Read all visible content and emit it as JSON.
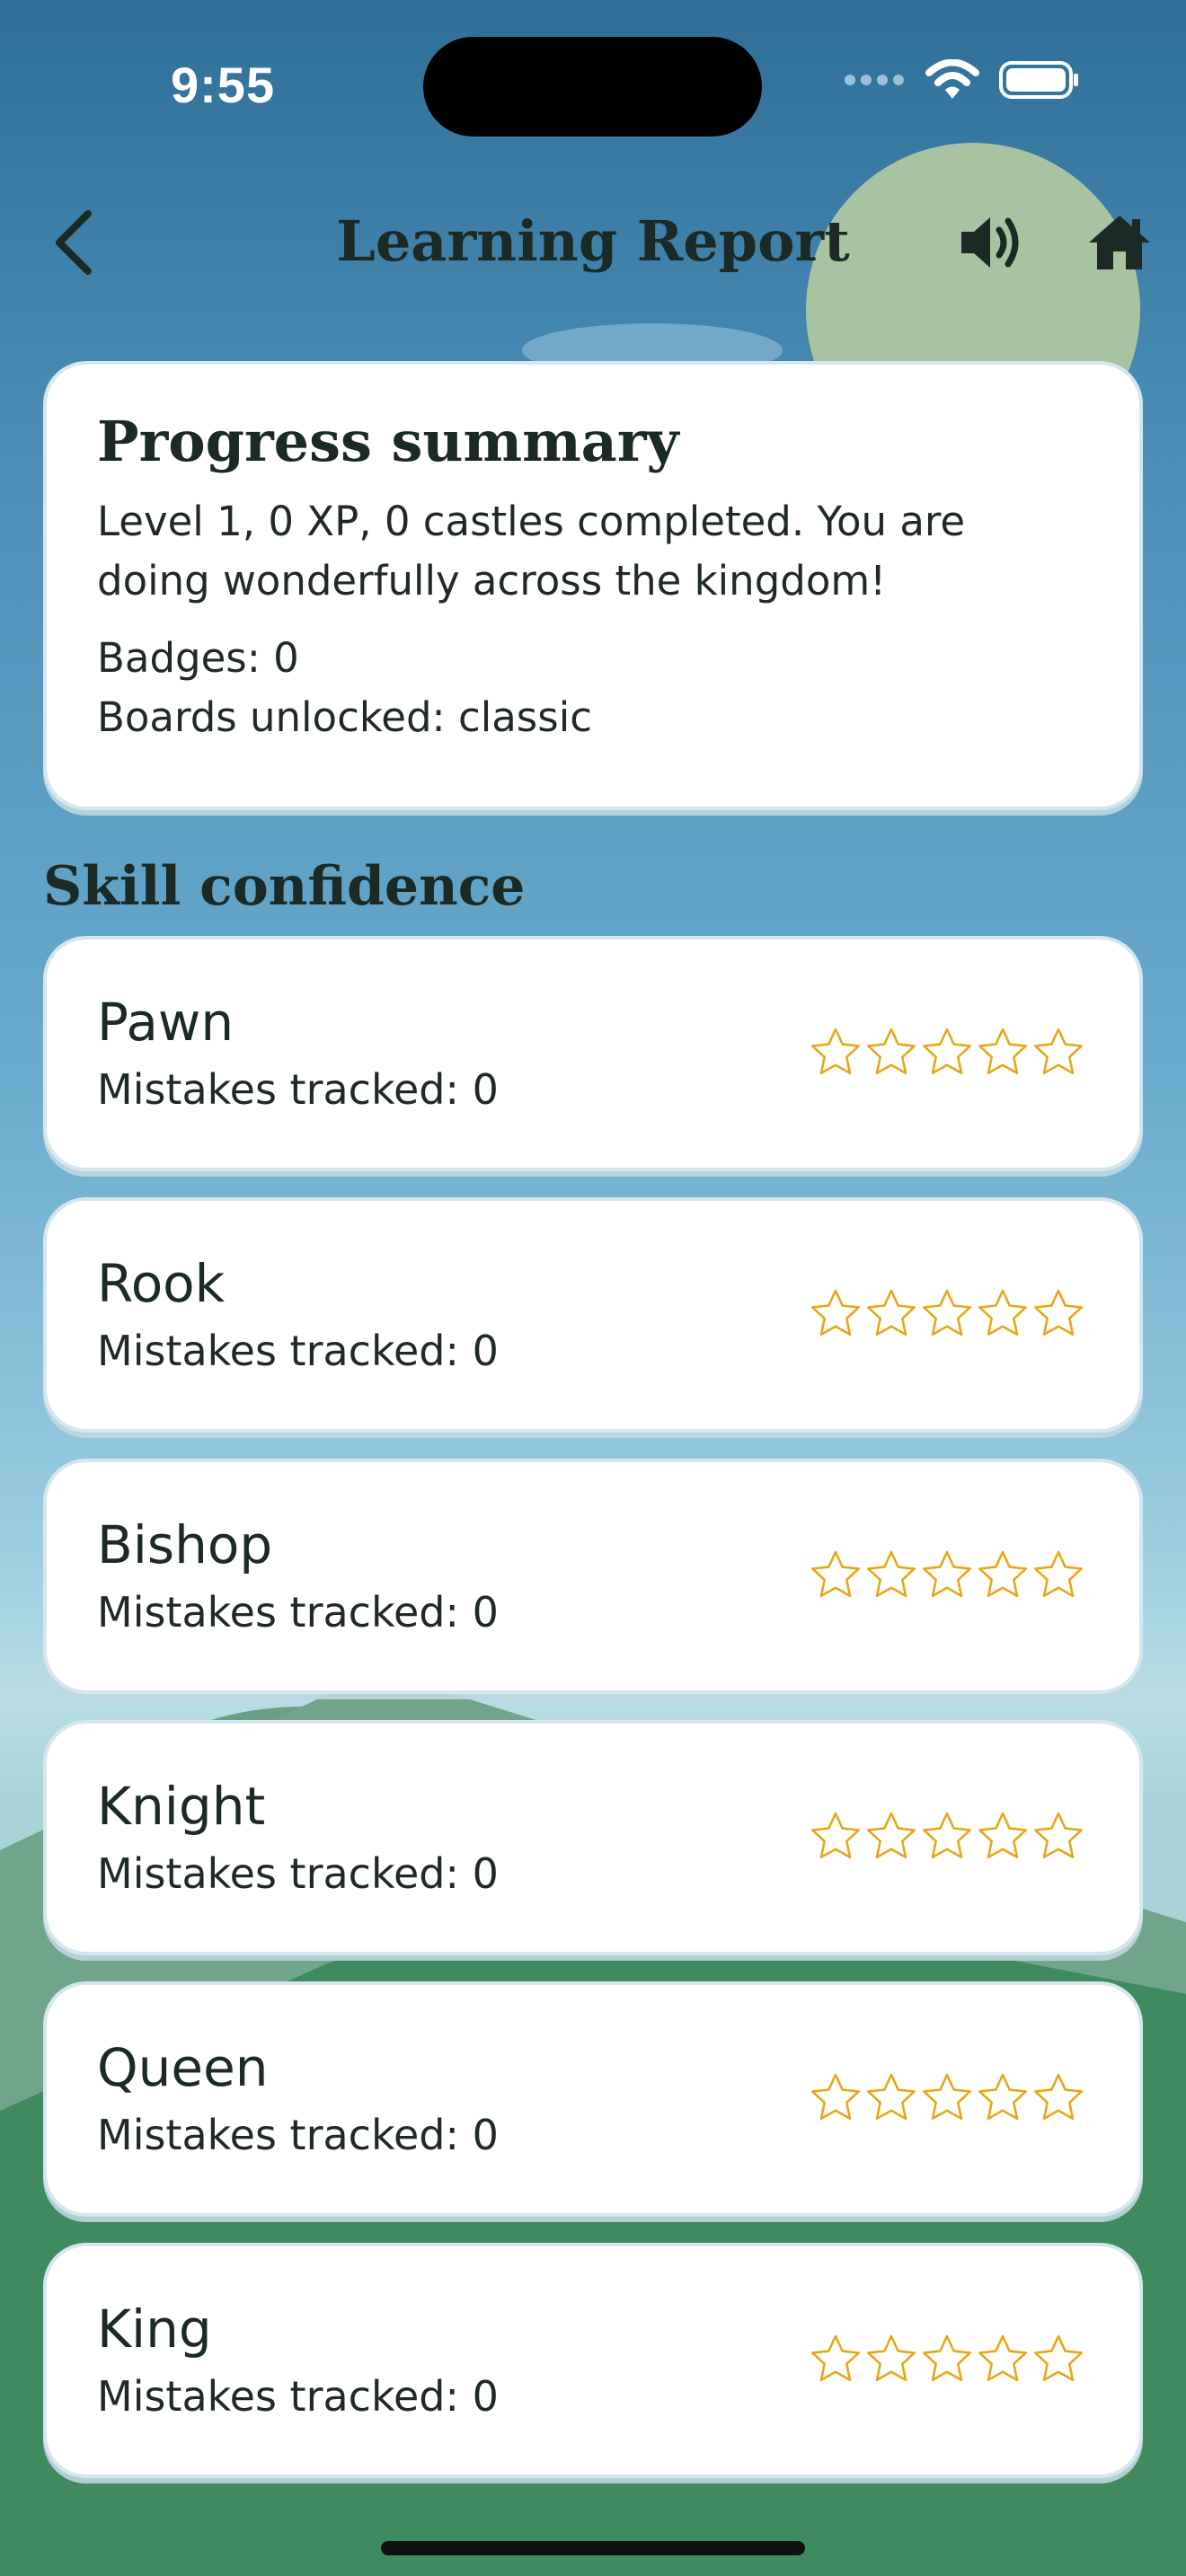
{
  "status_bar": {
    "time": "9:55"
  },
  "nav": {
    "title": "Learning Report",
    "back_icon": "chevron-left-icon",
    "sound_icon": "speaker-icon",
    "home_icon": "home-icon"
  },
  "summary": {
    "title": "Progress summary",
    "text": "Level 1, 0 XP, 0 castles completed. You are doing wonderfully across the kingdom!",
    "badges": "Badges: 0",
    "boards": "Boards unlocked: classic"
  },
  "skills_section": {
    "title": "Skill confidence",
    "items": [
      {
        "name": "Pawn",
        "mistakes": "Mistakes tracked: 0",
        "rating": 0,
        "max_rating": 5
      },
      {
        "name": "Rook",
        "mistakes": "Mistakes tracked: 0",
        "rating": 0,
        "max_rating": 5
      },
      {
        "name": "Bishop",
        "mistakes": "Mistakes tracked: 0",
        "rating": 0,
        "max_rating": 5
      },
      {
        "name": "Knight",
        "mistakes": "Mistakes tracked: 0",
        "rating": 0,
        "max_rating": 5
      },
      {
        "name": "Queen",
        "mistakes": "Mistakes tracked: 0",
        "rating": 0,
        "max_rating": 5
      },
      {
        "name": "King",
        "mistakes": "Mistakes tracked: 0",
        "rating": 0,
        "max_rating": 5
      }
    ]
  },
  "colors": {
    "star": "#e6a817",
    "text": "#1b2a25",
    "hill_dark": "#3f8a5e",
    "hill_light": "#6aa88a",
    "sun": "#a8c3a2"
  }
}
